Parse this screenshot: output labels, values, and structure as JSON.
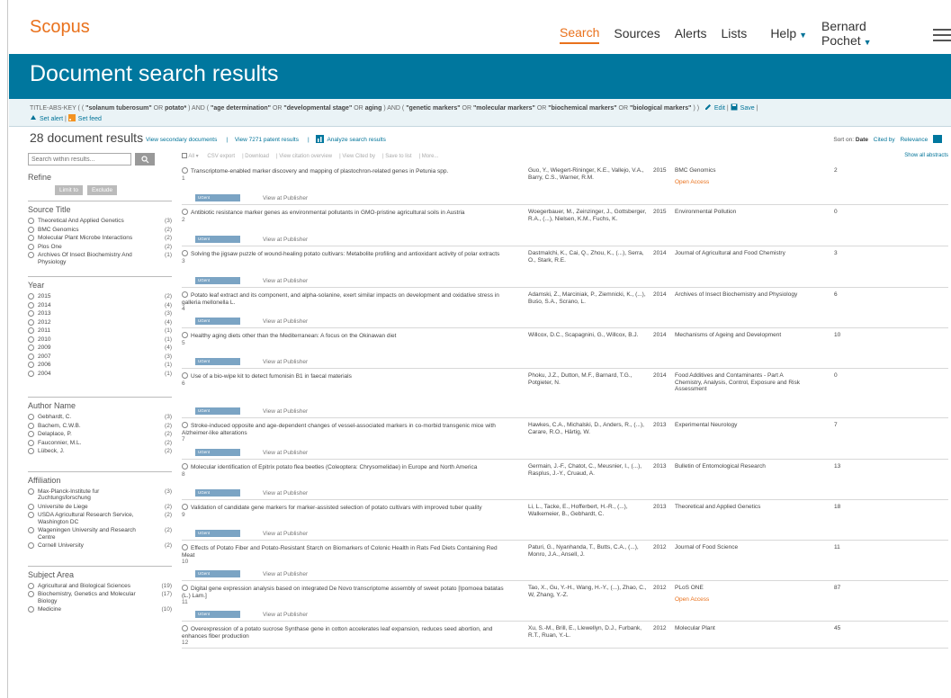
{
  "nav": {
    "logo": "Scopus",
    "links": [
      "Search",
      "Sources",
      "Alerts",
      "Lists"
    ],
    "help": "Help",
    "user": "Bernard Pochet"
  },
  "banner": {
    "title": "Document search results"
  },
  "query": {
    "prefix": "TITLE-ABS-KEY ( (",
    "t1": "\"solanum tuberosum\"",
    "t2": "OR",
    "t3": "potato*",
    "t4": ") AND (",
    "t5": "\"age determination\"",
    "t6": "OR",
    "t7": "\"developmental stage\"",
    "t8": "OR",
    "t9": "aging",
    "t10": ") AND (",
    "t11": "\"genetic markers\"",
    "t12": "OR",
    "t13": "\"molecular markers\"",
    "t14": "OR",
    "t15": "\"biochemical markers\"",
    "t16": "OR",
    "t17": "\"biological markers\"",
    "t18": ") )",
    "edit": "Edit",
    "save": "Save",
    "set_alert": "Set alert",
    "set_feed": "Set feed"
  },
  "results_bar": {
    "count": "28 document results",
    "links": [
      "View secondary documents",
      "View 7271 patent results",
      "Analyze search results"
    ],
    "sort_label": "Sort on:",
    "sort_options": [
      "Date",
      "Cited by",
      "Relevance"
    ]
  },
  "toolbar": {
    "all": "All",
    "items": [
      "CSV export",
      "Download",
      "View citation overview",
      "View Cited by",
      "Save to list",
      "More..."
    ],
    "show_all": "Show all abstracts"
  },
  "sidebar": {
    "search_placeholder": "Search within results...",
    "refine": "Refine",
    "limit_to": "Limit to",
    "exclude": "Exclude",
    "source_title": {
      "heading": "Source Title",
      "items": [
        {
          "label": "Theoretical And Applied Genetics",
          "count": "(3)"
        },
        {
          "label": "BMC Genomics",
          "count": "(2)"
        },
        {
          "label": "Molecular Plant Microbe Interactions",
          "count": "(2)"
        },
        {
          "label": "Plos One",
          "count": "(2)"
        },
        {
          "label": "Archives Of Insect Biochemistry And Physiology",
          "count": "(1)"
        }
      ]
    },
    "year": {
      "heading": "Year",
      "items": [
        {
          "label": "2015",
          "count": "(2)"
        },
        {
          "label": "2014",
          "count": "(4)"
        },
        {
          "label": "2013",
          "count": "(3)"
        },
        {
          "label": "2012",
          "count": "(4)"
        },
        {
          "label": "2011",
          "count": "(1)"
        },
        {
          "label": "2010",
          "count": "(1)"
        },
        {
          "label": "2009",
          "count": "(4)"
        },
        {
          "label": "2007",
          "count": "(3)"
        },
        {
          "label": "2006",
          "count": "(1)"
        },
        {
          "label": "2004",
          "count": "(1)"
        }
      ]
    },
    "author": {
      "heading": "Author Name",
      "items": [
        {
          "label": "Gebhardt, C.",
          "count": "(3)"
        },
        {
          "label": "Bachem, C.W.B.",
          "count": "(2)"
        },
        {
          "label": "Delaplace, P.",
          "count": "(2)"
        },
        {
          "label": "Fauconnier, M.L.",
          "count": "(2)"
        },
        {
          "label": "Lübeck, J.",
          "count": "(2)"
        }
      ]
    },
    "affiliation": {
      "heading": "Affiliation",
      "items": [
        {
          "label": "Max-Planck-Institute fur Zuchtungsforschung",
          "count": "(3)"
        },
        {
          "label": "Universite de Liege",
          "count": "(2)"
        },
        {
          "label": "USDA Agricultural Research Service, Washington DC",
          "count": "(2)"
        },
        {
          "label": "Wageningen University and Research Centre",
          "count": "(2)"
        },
        {
          "label": "Cornell University",
          "count": "(2)"
        }
      ]
    },
    "subject": {
      "heading": "Subject Area",
      "items": [
        {
          "label": "Agricultural and Biological Sciences",
          "count": "(19)"
        },
        {
          "label": "Biochemistry, Genetics and Molecular Biology",
          "count": "(17)"
        },
        {
          "label": "Medicine",
          "count": "(10)"
        }
      ]
    }
  },
  "results": [
    {
      "title": "Transcriptome-enabled marker discovery and mapping of plastochron-related genes in Petunia spp.",
      "num": "1",
      "authors": "Guo, Y., Wiegert-Rininger, K.E., Vallejo, V.A., Barry, C.S., Warner, R.M.",
      "year": "2015",
      "source": "BMC Genomics",
      "cited": "2",
      "oa": "Open Access"
    },
    {
      "title": "Antibiotic resistance marker genes as environmental pollutants in GMO-pristine agricultural soils in Austria",
      "num": "2",
      "authors": "Woegerbauer, M., Zeinzinger, J., Gottsberger, R.A., (...), Nielsen, K.M., Fuchs, K.",
      "year": "2015",
      "source": "Environmental Pollution",
      "cited": "0",
      "oa": ""
    },
    {
      "title": "Solving the jigsaw puzzle of wound-healing potato cultivars: Metabolite profiling and antioxidant activity of polar extracts",
      "num": "3",
      "authors": "Dastmalchi, K., Cai, Q., Zhou, K., (...), Serra, O., Stark, R.E.",
      "year": "2014",
      "source": "Journal of Agricultural and Food Chemistry",
      "cited": "3",
      "oa": ""
    },
    {
      "title": "Potato leaf extract and its component, and alpha-solanine, exert similar impacts on development and oxidative stress in galleria mellonella L.",
      "num": "4",
      "authors": "Adamski, Z., Marciniak, P., Ziemnicki, K., (...), Buśo, S.A., Scrano, L.",
      "year": "2014",
      "source": "Archives of Insect Biochemistry and Physiology",
      "cited": "6",
      "oa": ""
    },
    {
      "title": "Healthy aging diets other than the Mediterranean: A focus on the Okinawan diet",
      "num": "5",
      "authors": "Willcox, D.C., Scapagnini, G., Willcox, B.J.",
      "year": "2014",
      "source": "Mechanisms of Ageing and Development",
      "cited": "10",
      "oa": ""
    },
    {
      "title": "Use of a bio-wipe kit to detect fumonisin B1 in faecal materials",
      "num": "6",
      "authors": "Phoku, J.Z., Dutton, M.F., Barnard, T.G., Potgieter, N.",
      "year": "2014",
      "source": "Food Additives and Contaminants - Part A Chemistry, Analysis, Control, Exposure and Risk Assessment",
      "cited": "0",
      "oa": ""
    },
    {
      "title": "Stroke-induced opposite and age-dependent changes of vessel-associated markers in co-morbid transgenic mice with Alzheimer-like alterations",
      "num": "7",
      "authors": "Hawkes, C.A., Michalski, D., Anders, R., (...), Carare, R.O., Härtig, W.",
      "year": "2013",
      "source": "Experimental Neurology",
      "cited": "7",
      "oa": ""
    },
    {
      "title": "Molecular identification of Epitrix potato flea beetles (Coleoptera: Chrysomelidae) in Europe and North America",
      "num": "8",
      "authors": "Germain, J.-F., Chatot, C., Meusnier, I., (...), Rasplus, J.-Y., Cruaud, A.",
      "year": "2013",
      "source": "Bulletin of Entomological Research",
      "cited": "13",
      "oa": ""
    },
    {
      "title": "Validation of candidate gene markers for marker-assisted selection of potato cultivars with improved tuber quality",
      "num": "9",
      "authors": "Li, L., Tacke, E., Hofferbert, H.-R., (...), Walkemeier, B., Gebhardt, C.",
      "year": "2013",
      "source": "Theoretical and Applied Genetics",
      "cited": "18",
      "oa": ""
    },
    {
      "title": "Effects of Potato Fiber and Potato-Resistant Starch on Biomarkers of Colonic Health in Rats Fed Diets Containing Red Meat",
      "num": "10",
      "authors": "Paturi, G., Nyanhanda, T., Butts, C.A., (...), Monro, J.A., Ansell, J.",
      "year": "2012",
      "source": "Journal of Food Science",
      "cited": "11",
      "oa": ""
    },
    {
      "title": "Digital gene expression analysis based on integrated De Novo transcriptome assembly of sweet potato [Ipomoea batatas (L.) Lam.]",
      "num": "11",
      "authors": "Tao, X., Gu, Y.-H., Wang, H.-Y., (...), Zhao, C., W, Zhang, Y.-Z.",
      "year": "2012",
      "source": "PLoS ONE",
      "cited": "87",
      "oa": "Open Access"
    },
    {
      "title": "Overexpression of a potato sucrose Synthase gene in cotton accelerates leaf expansion, reduces seed abortion, and enhances fiber production",
      "num": "12",
      "authors": "Xu, S.-M., Brill, E., Llewellyn, D.J., Furbank, R.T., Ruan, Y.-L.",
      "year": "2012",
      "source": "Molecular Plant",
      "cited": "45",
      "oa": ""
    }
  ],
  "row_labels": {
    "sfx": "UGent",
    "publisher": "View at Publisher"
  }
}
